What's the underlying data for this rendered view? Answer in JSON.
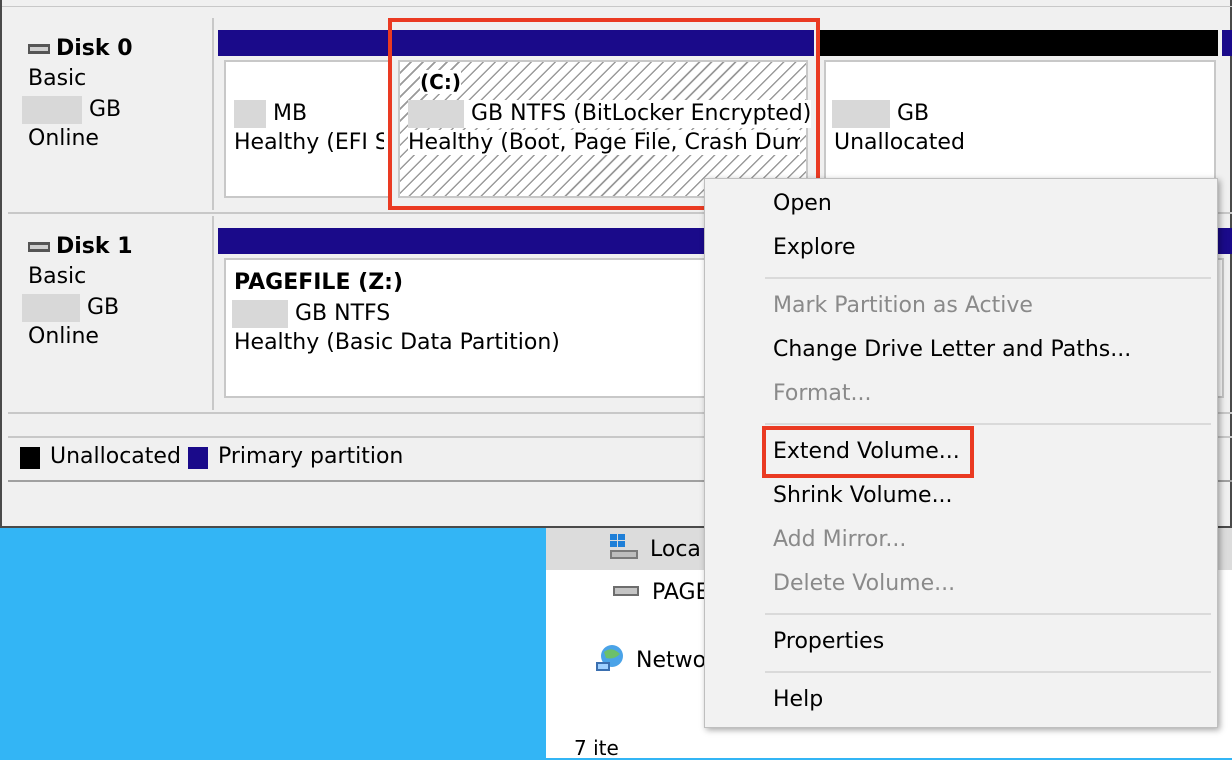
{
  "explorer": {
    "items": [
      {
        "label": "Loca",
        "icon": "local-disk-icon"
      },
      {
        "label": "PAGE",
        "icon": "drive-icon"
      },
      {
        "label": "Netwo",
        "icon": "network-icon"
      },
      {
        "label": "7 ite",
        "icon": ""
      }
    ]
  },
  "disks": [
    {
      "name": "Disk 0",
      "type": "Basic",
      "size_unit": "GB",
      "status": "Online",
      "partitions": [
        {
          "size_unit": "MB",
          "health": "Healthy (EFI S"
        },
        {
          "label": "(C:)",
          "size_unit": "GB NTFS (BitLocker Encrypted)",
          "health": "Healthy (Boot, Page File, Crash Dump"
        },
        {
          "size_unit": "GB",
          "health": "Unallocated"
        }
      ]
    },
    {
      "name": "Disk 1",
      "type": "Basic",
      "size_unit": "GB",
      "status": "Online",
      "partitions": [
        {
          "label": "PAGEFILE  (Z:)",
          "size_unit": "GB NTFS",
          "health": "Healthy (Basic Data Partition)"
        }
      ]
    }
  ],
  "legend": [
    {
      "label": "Unallocated",
      "color": "#000000"
    },
    {
      "label": "Primary partition",
      "color": "#1a0a8a"
    }
  ],
  "context_menu": {
    "items": [
      {
        "label": "Open",
        "enabled": true
      },
      {
        "label": "Explore",
        "enabled": true
      },
      {
        "label": "Mark Partition as Active",
        "enabled": false
      },
      {
        "label": "Change Drive Letter and Paths...",
        "enabled": true
      },
      {
        "label": "Format...",
        "enabled": false
      },
      {
        "label": "Extend Volume...",
        "enabled": true,
        "highlighted": true
      },
      {
        "label": "Shrink Volume...",
        "enabled": true
      },
      {
        "label": "Add Mirror...",
        "enabled": false
      },
      {
        "label": "Delete Volume...",
        "enabled": false
      },
      {
        "label": "Properties",
        "enabled": true
      },
      {
        "label": "Help",
        "enabled": true
      }
    ]
  },
  "colors": {
    "primary_partition": "#1a0a8a",
    "unallocated": "#000000",
    "highlight": "#ea3a22",
    "desktop": "#33b5f5"
  }
}
